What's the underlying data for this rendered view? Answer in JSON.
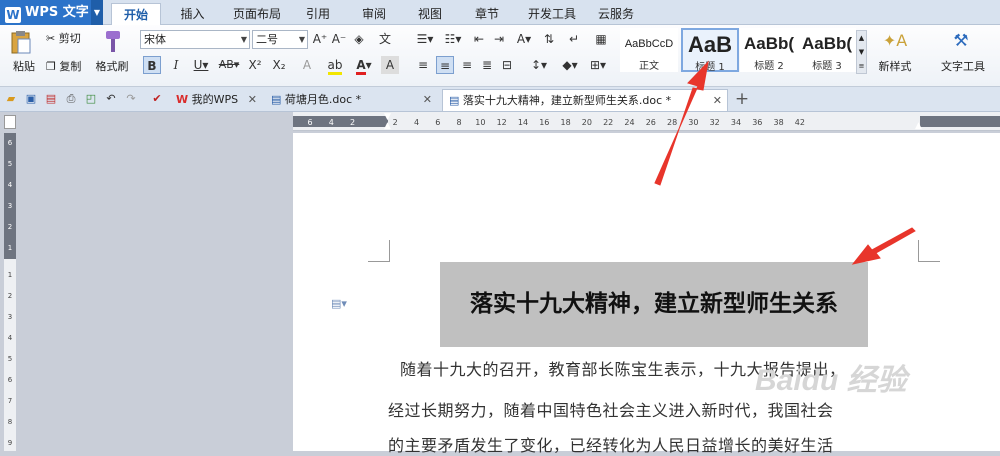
{
  "app": {
    "name": "WPS 文字",
    "logo_letter": "W"
  },
  "menu_tabs": [
    "开始",
    "插入",
    "页面布局",
    "引用",
    "审阅",
    "视图",
    "章节",
    "开发工具",
    "云服务"
  ],
  "active_tab": "开始",
  "clipboard": {
    "paste": "粘贴",
    "cut": "剪切",
    "copy": "复制",
    "format_painter": "格式刷"
  },
  "font": {
    "family": "宋体",
    "size": "二号"
  },
  "styles": [
    {
      "preview": "AaBbCcD",
      "label": "正文"
    },
    {
      "preview": "AaB",
      "label": "标题 1"
    },
    {
      "preview": "AaBb(",
      "label": "标题 2"
    },
    {
      "preview": "AaBb(",
      "label": "标题 3"
    }
  ],
  "new_style": "新样式",
  "text_tools": "文字工具",
  "doc_tabs": [
    {
      "label": "我的WPS"
    },
    {
      "label": "荷塘月色.doc *"
    },
    {
      "label": "落实十九大精神，建立新型师生关系.doc *"
    }
  ],
  "ruler_h": [
    "6",
    "4",
    "2",
    "2",
    "4",
    "6",
    "8",
    "10",
    "12",
    "14",
    "16",
    "18",
    "20",
    "22",
    "24",
    "26",
    "28",
    "30",
    "32",
    "34",
    "36",
    "38",
    "42"
  ],
  "ruler_v": [
    "6",
    "5",
    "4",
    "3",
    "2",
    "1",
    "1",
    "2",
    "3",
    "4",
    "5",
    "6",
    "7",
    "8",
    "9"
  ],
  "document": {
    "title": "落实十九大精神，建立新型师生关系",
    "paragraphs": [
      "随着十九大的召开，教育部长陈宝生表示，十九大报告提出，",
      "经过长期努力，随着中国特色社会主义进入新时代，我国社会",
      "的主要矛盾发生了变化，已经转化为人民日益增长的美好生活"
    ]
  },
  "watermark": "Baidu 经验",
  "colors": {
    "accent": "#2c73c9",
    "arrow": "#e8352b",
    "highlight": "#c0c0c0"
  }
}
